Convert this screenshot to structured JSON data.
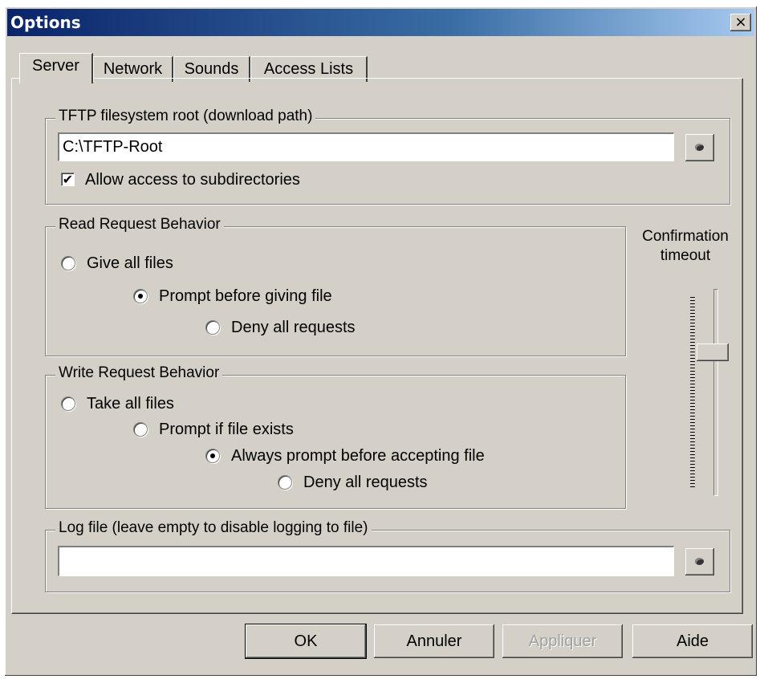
{
  "window": {
    "title": "Options",
    "close_symbol": "×"
  },
  "tabs": [
    {
      "label": "Server",
      "active": true
    },
    {
      "label": "Network",
      "active": false
    },
    {
      "label": "Sounds",
      "active": false
    },
    {
      "label": "Access Lists",
      "active": false
    }
  ],
  "tftp_root": {
    "legend": "TFTP filesystem root (download path)",
    "value": "C:\\TFTP-Root",
    "allow_subdirs_label": "Allow access to subdirectories",
    "allow_subdirs_checked": true
  },
  "read_request": {
    "legend": "Read Request Behavior",
    "options": [
      {
        "label": "Give all files",
        "selected": false
      },
      {
        "label": "Prompt before giving file",
        "selected": true
      },
      {
        "label": "Deny all requests",
        "selected": false
      }
    ]
  },
  "write_request": {
    "legend": "Write Request Behavior",
    "options": [
      {
        "label": "Take all files",
        "selected": false
      },
      {
        "label": "Prompt if file exists",
        "selected": false
      },
      {
        "label": "Always prompt before accepting file",
        "selected": true
      },
      {
        "label": "Deny all requests",
        "selected": false
      }
    ]
  },
  "confirmation_timeout": {
    "label_line1": "Confirmation",
    "label_line2": "timeout"
  },
  "log_file": {
    "legend": "Log file (leave empty to disable logging to file)",
    "value": ""
  },
  "buttons": {
    "ok": "OK",
    "cancel": "Annuler",
    "apply": "Appliquer",
    "help": "Aide"
  },
  "icons": {
    "browse": "folder-browse-icon",
    "check": "✔"
  }
}
